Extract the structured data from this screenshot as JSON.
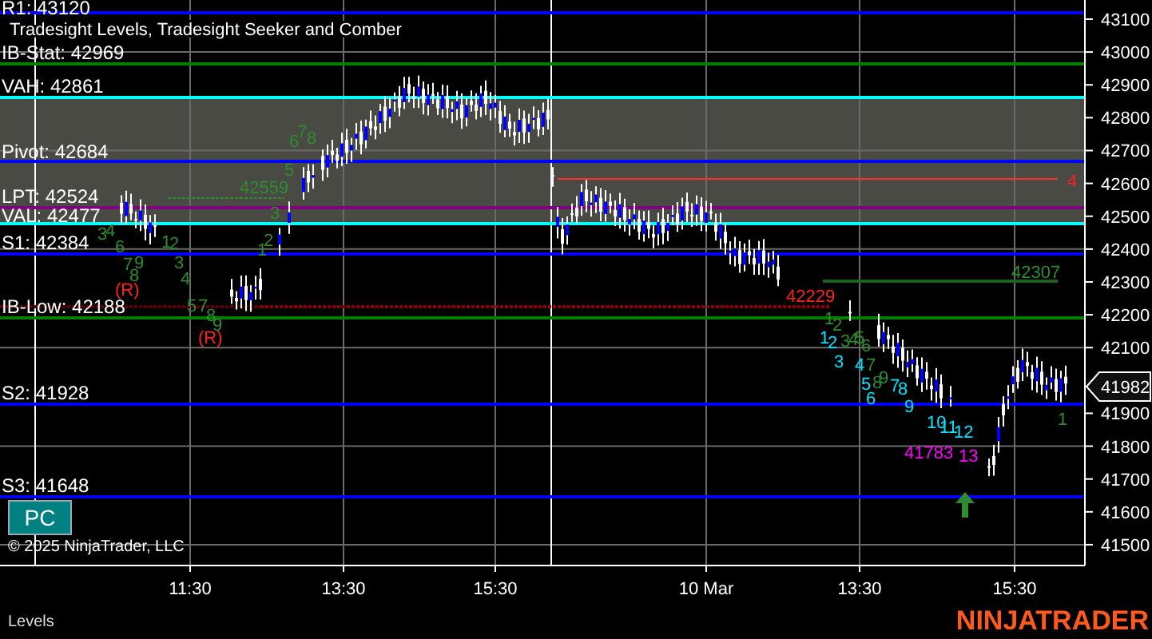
{
  "chart": {
    "title": "Tradesight Levels, Tradesight Seeker and Comber",
    "levels": [
      {
        "label": "R1: 43120",
        "color": "#0000ff"
      },
      {
        "label": "IB-Stat: 42969",
        "color": "#008000"
      },
      {
        "label": "VAH: 42861",
        "color": "#00ffff"
      },
      {
        "label": "Pivot: 42684",
        "color": "#0000ff"
      },
      {
        "label": "LPT: 42524",
        "color": "#800080"
      },
      {
        "label": "VAL: 42477",
        "color": "#00ffff"
      },
      {
        "label": "S1: 42384",
        "color": "#0000ff"
      },
      {
        "label": "IB-Low: 42188",
        "color": "#008000"
      },
      {
        "label": "S2: 41928",
        "color": "#0000ff"
      },
      {
        "label": "S3: 41648",
        "color": "#0000ff"
      }
    ],
    "price_labels": [
      {
        "text": "42559",
        "color": "#2e8b2e"
      },
      {
        "text": "42307",
        "color": "#2e8b2e"
      },
      {
        "text": "42229",
        "color": "#ff2020"
      },
      {
        "text": "41783",
        "color": "#ff00ff"
      },
      {
        "text": "4",
        "color": "#ff2020"
      }
    ],
    "counts": [
      {
        "text": "3",
        "color": "#2e8b2e"
      },
      {
        "text": "4",
        "color": "#2e8b2e"
      },
      {
        "text": "6",
        "color": "#2e8b2e"
      },
      {
        "text": "7",
        "color": "#2e8b2e"
      },
      {
        "text": "9",
        "color": "#2e8b2e"
      },
      {
        "text": "8",
        "color": "#2e8b2e"
      },
      {
        "text": "1",
        "color": "#2e8b2e"
      },
      {
        "text": "2",
        "color": "#2e8b2e"
      },
      {
        "text": "3",
        "color": "#2e8b2e"
      },
      {
        "text": "4",
        "color": "#2e8b2e"
      },
      {
        "text": "5",
        "color": "#2e8b2e"
      },
      {
        "text": "7",
        "color": "#2e8b2e"
      },
      {
        "text": "8",
        "color": "#2e8b2e"
      },
      {
        "text": "9",
        "color": "#2e8b2e"
      },
      {
        "text": "1",
        "color": "#2e8b2e"
      },
      {
        "text": "2",
        "color": "#2e8b2e"
      },
      {
        "text": "3",
        "color": "#2e8b2e"
      },
      {
        "text": "5",
        "color": "#2e8b2e"
      },
      {
        "text": "6",
        "color": "#2e8b2e"
      },
      {
        "text": "7",
        "color": "#2e8b2e"
      },
      {
        "text": "8",
        "color": "#2e8b2e"
      },
      {
        "text": "1",
        "color": "#2e8b2e"
      },
      {
        "text": "2",
        "color": "#2e8b2e"
      },
      {
        "text": "3",
        "color": "#2e8b2e"
      },
      {
        "text": "4",
        "color": "#2e8b2e"
      },
      {
        "text": "5",
        "color": "#2e8b2e"
      },
      {
        "text": "6",
        "color": "#2e8b2e"
      },
      {
        "text": "7",
        "color": "#2e8b2e"
      },
      {
        "text": "8",
        "color": "#2e8b2e"
      },
      {
        "text": "9",
        "color": "#2e8b2e"
      },
      {
        "text": "1",
        "color": "#00e5ff"
      },
      {
        "text": "2",
        "color": "#00e5ff"
      },
      {
        "text": "3",
        "color": "#00e5ff"
      },
      {
        "text": "4",
        "color": "#00e5ff"
      },
      {
        "text": "5",
        "color": "#00e5ff"
      },
      {
        "text": "6",
        "color": "#00e5ff"
      },
      {
        "text": "7",
        "color": "#00e5ff"
      },
      {
        "text": "8",
        "color": "#00e5ff"
      },
      {
        "text": "9",
        "color": "#00e5ff"
      },
      {
        "text": "10",
        "color": "#00e5ff"
      },
      {
        "text": "11",
        "color": "#00e5ff"
      },
      {
        "text": "12",
        "color": "#00e5ff"
      },
      {
        "text": "13",
        "color": "#ff00ff"
      },
      {
        "text": "1",
        "color": "#2e8b2e"
      }
    ],
    "reversal_marks": [
      "(R)",
      "(R)"
    ],
    "last_price": "41982",
    "button": "PC",
    "copyright": "© 2025 NinjaTrader, LLC",
    "price_ticks": [
      "43100",
      "43000",
      "42900",
      "42800",
      "42700",
      "42600",
      "42500",
      "42400",
      "42300",
      "42200",
      "42100",
      "41900",
      "41800",
      "41700",
      "41600",
      "41500"
    ],
    "time_ticks": [
      "11:30",
      "13:30",
      "15:30",
      "10 Mar",
      "13:30",
      "15:30"
    ]
  },
  "status_bar": {
    "tab": "Levels"
  },
  "logo": "NINJATRADER"
}
